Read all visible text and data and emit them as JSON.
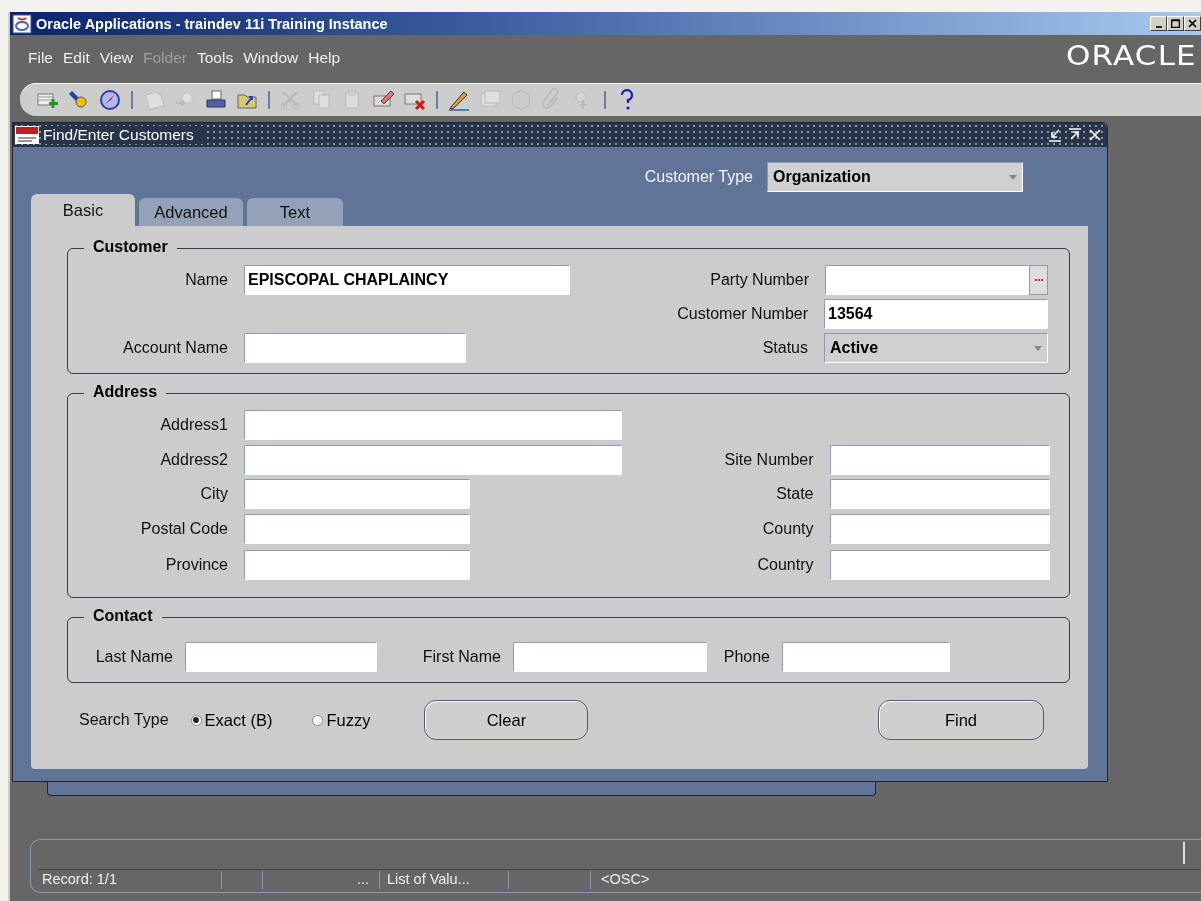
{
  "window": {
    "title": "Oracle Applications - traindev 11i Training Instance"
  },
  "menu": [
    {
      "label": "File",
      "disabled": false
    },
    {
      "label": "Edit",
      "disabled": false
    },
    {
      "label": "View",
      "disabled": false
    },
    {
      "label": "Folder",
      "disabled": true
    },
    {
      "label": "Tools",
      "disabled": false
    },
    {
      "label": "Window",
      "disabled": false
    },
    {
      "label": "Help",
      "disabled": false
    }
  ],
  "logo": "ORACLE",
  "toolbar": [
    {
      "kind": "new",
      "disabled": false
    },
    {
      "kind": "find",
      "disabled": false
    },
    {
      "kind": "navigator",
      "disabled": false
    },
    {
      "kind": "separator"
    },
    {
      "kind": "save",
      "disabled": true
    },
    {
      "kind": "next-step",
      "disabled": true
    },
    {
      "kind": "print",
      "disabled": false
    },
    {
      "kind": "close-form",
      "disabled": false
    },
    {
      "kind": "separator"
    },
    {
      "kind": "cut",
      "disabled": true
    },
    {
      "kind": "copy",
      "disabled": true
    },
    {
      "kind": "paste",
      "disabled": true
    },
    {
      "kind": "clear-record",
      "disabled": false
    },
    {
      "kind": "delete-record",
      "disabled": false
    },
    {
      "kind": "separator"
    },
    {
      "kind": "edit-field",
      "disabled": false
    },
    {
      "kind": "zoom",
      "disabled": true
    },
    {
      "kind": "translations",
      "disabled": true
    },
    {
      "kind": "attachments",
      "disabled": true
    },
    {
      "kind": "folder-tools",
      "disabled": true
    },
    {
      "kind": "separator"
    },
    {
      "kind": "help",
      "disabled": false
    }
  ],
  "form": {
    "title": "Find/Enter Customers",
    "customer_type": {
      "label": "Customer Type",
      "value": "Organization"
    },
    "tabs": [
      {
        "label": "Basic",
        "selected": true
      },
      {
        "label": "Advanced",
        "selected": false
      },
      {
        "label": "Text",
        "selected": false
      }
    ],
    "groups": [
      {
        "title": "Customer",
        "rows": [
          {
            "left": {
              "label": "Name",
              "kind": "text",
              "value": "EPISCOPAL CHAPLAINCY"
            },
            "right": {
              "label": "Party Number",
              "kind": "lov"
            }
          },
          {
            "right": {
              "label": "Customer Number",
              "kind": "text",
              "value": "13564"
            }
          },
          {
            "left": {
              "label": "Account Name",
              "kind": "text"
            },
            "right": {
              "label": "Status",
              "kind": "dropdown",
              "value": "Active"
            }
          }
        ]
      },
      {
        "title": "Address",
        "rows": [
          {
            "left": {
              "label": "Address1",
              "kind": "text"
            }
          },
          {
            "left": {
              "label": "Address2",
              "kind": "text"
            },
            "right": {
              "label": "Site Number",
              "kind": "text"
            }
          },
          {
            "left": {
              "label": "City",
              "kind": "text"
            },
            "right": {
              "label": "State",
              "kind": "text"
            }
          },
          {
            "left": {
              "label": "Postal Code",
              "kind": "text"
            },
            "right": {
              "label": "County",
              "kind": "text"
            }
          },
          {
            "left": {
              "label": "Province",
              "kind": "text"
            },
            "right": {
              "label": "Country",
              "kind": "text"
            }
          }
        ]
      },
      {
        "title": "Contact",
        "fields": [
          {
            "label": "Last Name",
            "kind": "text"
          },
          {
            "label": "First Name",
            "kind": "text"
          },
          {
            "label": "Phone",
            "kind": "text"
          }
        ]
      }
    ],
    "search_type": {
      "label": "Search Type",
      "options": [
        {
          "label": "Exact (B)",
          "selected": true
        },
        {
          "label": "Fuzzy",
          "selected": false
        }
      ]
    },
    "buttons": [
      {
        "label": "Clear"
      },
      {
        "label": "Find"
      }
    ]
  },
  "status_bar": {
    "record": "Record: 1/1",
    "lov_marker": "...",
    "message": "List of Valu...",
    "mode": "<OSC>"
  }
}
